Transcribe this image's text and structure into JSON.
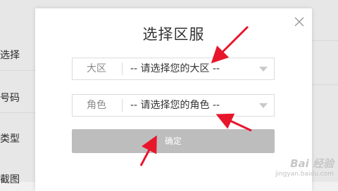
{
  "background": {
    "labels": [
      "选择",
      "号码",
      "类型",
      "截图"
    ]
  },
  "modal": {
    "title": "选择区服",
    "close_glyph": "×",
    "region": {
      "label": "大区",
      "value": "-- 请选择您的大区 --"
    },
    "role": {
      "label": "角色",
      "value": "-- 请选择您的角色 --"
    },
    "confirm_label": "确定"
  },
  "watermark": {
    "main": "Bai 经验",
    "sub": "jingyan.baidu.com"
  },
  "colors": {
    "arrow": "#e8162b",
    "button_disabled": "#bdbdbd"
  }
}
